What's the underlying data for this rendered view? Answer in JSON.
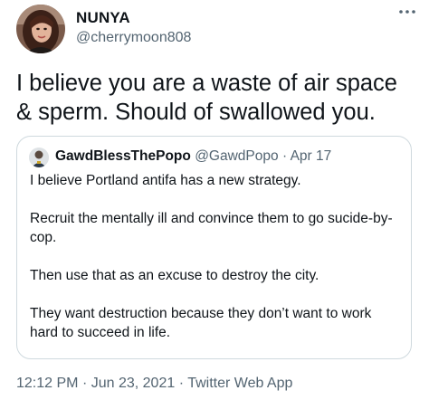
{
  "author": {
    "name": "NUNYA",
    "handle": "@cherrymoon808"
  },
  "tweet": {
    "text": "I believe you are a waste of air space & sperm. Should of swallowed you."
  },
  "quoted_tweet": {
    "name": "GawdBlessThePopo",
    "handle": "@GawdPopo",
    "separator": "·",
    "date": "Apr 17",
    "paragraphs": [
      "I believe Portland antifa has a new strategy.",
      "Recruit the mentally ill and convince them to go sucide-by-cop.",
      "Then use that as an excuse to destroy the city.",
      "They want destruction because they don’t want to work hard to succeed in life."
    ]
  },
  "meta": {
    "time": "12:12 PM",
    "separator1": "·",
    "date": "Jun 23, 2021",
    "separator2": "·",
    "source": "Twitter Web App"
  },
  "colors": {
    "text_primary": "#0f1419",
    "text_secondary": "#536471",
    "border": "#cfd9de"
  },
  "icons": {
    "more": "more-horizontal-icon"
  }
}
